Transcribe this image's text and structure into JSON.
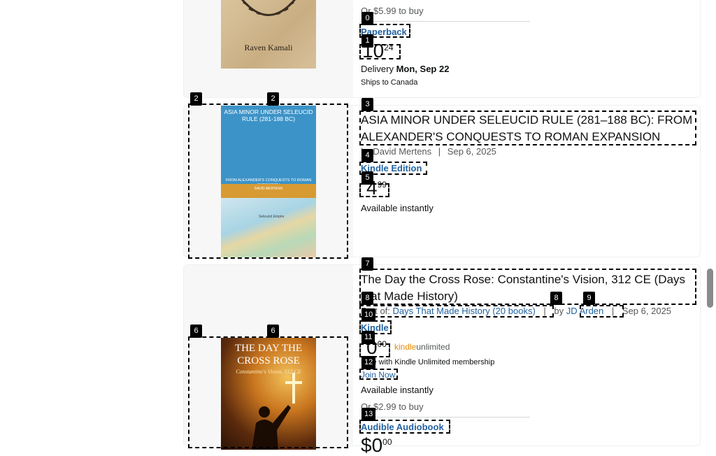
{
  "cards": [
    {
      "cover_author": "Raven Kamali",
      "buy_text": "Or $5.99 to buy",
      "format": "Paperback",
      "price_whole": "10",
      "price_fraction": "24",
      "delivery_label": "Delivery",
      "delivery_date": "Mon, Sep 22",
      "ships_to": "Ships to Canada"
    },
    {
      "cover_title": "ASIA MINOR UNDER SELEUCID RULE (281-188 BC)",
      "cover_subtitle": "FROM ALEXANDER'S CONQUESTS TO ROMAN EXPANSION",
      "cover_author": "DAVID MERTENS",
      "cover_map_label": "Seleucid Empire",
      "title": "ASIA MINOR UNDER SELEUCID RULE (281–188 BC): FROM ALEXANDER'S CONQUESTS TO ROMAN EXPANSION",
      "byline": "by David Mertens",
      "separator": "|",
      "date": "Sep 6, 2025",
      "format": "Kindle Edition",
      "price_whole": "4",
      "price_fraction": "99",
      "availability": "Available instantly"
    },
    {
      "cover_title": "THE DAY THE CROSS ROSE",
      "cover_subtitle": "Constantine's Vision, 312 CE",
      "title": "The Day the Cross Rose: Constantine's Vision, 312 CE (Days that Made History)",
      "series_prefix": "Part of:",
      "series_link": "Days That Made History (20 books)",
      "by_label": "by",
      "author_link": "JD Arden",
      "separator": "|",
      "date": "Sep 6, 2025",
      "format": "Kindle",
      "price_whole": "0",
      "price_fraction": "00",
      "ku_logo_kindle": "kindle",
      "ku_logo_unlimited": "unlimited",
      "ku_text": "Free with Kindle Unlimited membership",
      "join_now": "Join Now",
      "availability": "Available instantly",
      "buy_text": "Or $2.99 to buy",
      "audible_format": "Audible Audiobook",
      "audible_price_whole": "$0",
      "audible_price_fraction": "00"
    }
  ],
  "badges": [
    "0",
    "1",
    "2",
    "2",
    "3",
    "4",
    "5",
    "6",
    "6",
    "7",
    "8",
    "8",
    "9",
    "10",
    "11",
    "12",
    "13"
  ]
}
